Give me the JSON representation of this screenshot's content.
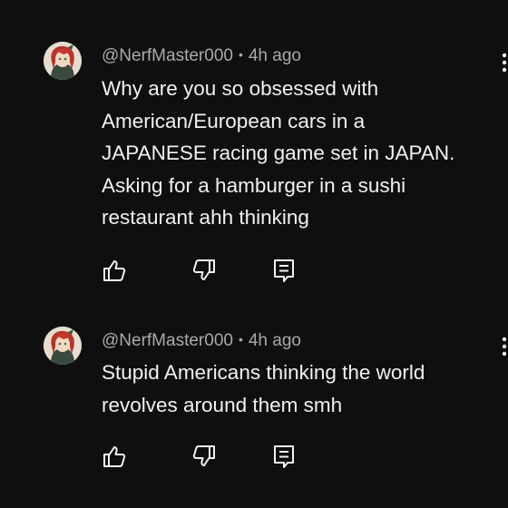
{
  "comments": [
    {
      "username": "@NerfMaster000",
      "separator": "•",
      "timestamp": "4h ago",
      "lines": [
        "Why are you so obsessed with",
        "American/European cars in a",
        "JAPANESE racing game set in JAPAN.",
        "Asking for a hamburger in a sushi",
        "restaurant ahh thinking"
      ],
      "avatar_icon": "anime-avatar",
      "actions": [
        "thumbs-up-icon",
        "thumbs-down-icon",
        "reply-icon"
      ],
      "menu_icon": "more-vertical-icon"
    },
    {
      "username": "@NerfMaster000",
      "separator": "•",
      "timestamp": "4h ago",
      "lines": [
        "Stupid Americans thinking the world",
        "revolves around them smh"
      ],
      "avatar_icon": "anime-avatar",
      "actions": [
        "thumbs-up-icon",
        "thumbs-down-icon",
        "reply-icon"
      ],
      "menu_icon": "more-vertical-icon"
    }
  ],
  "colors": {
    "background": "#0f0f0f",
    "primary_text": "#f1f1f1",
    "secondary_text": "#aaaaaa"
  }
}
